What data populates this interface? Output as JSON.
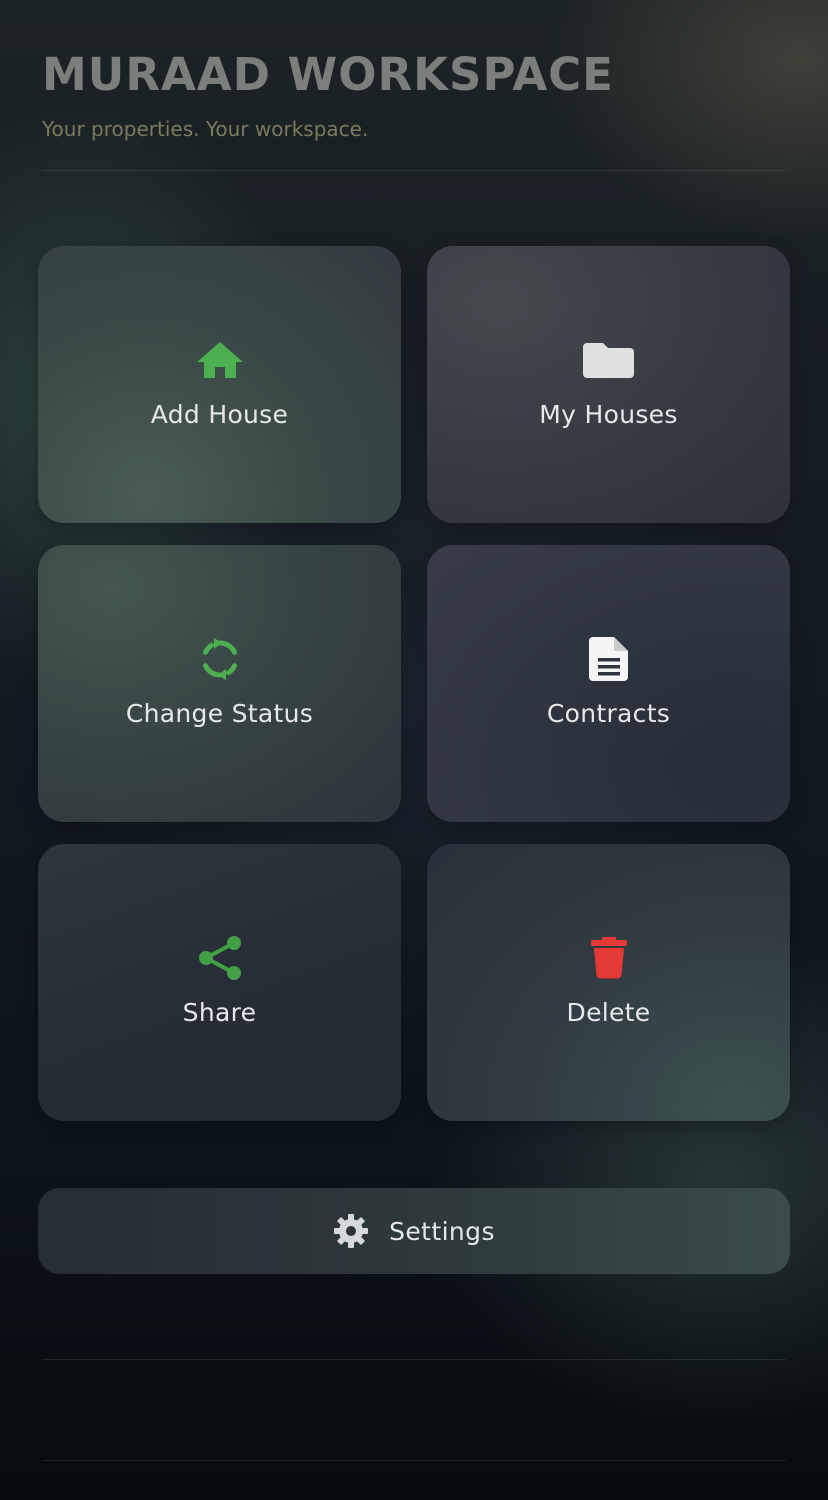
{
  "header": {
    "title": "MURAAD WORKSPACE",
    "subtitle": "Your properties. Your workspace."
  },
  "tiles": [
    {
      "label": "Add House",
      "icon": "house-icon",
      "icon_color": "#4caf50"
    },
    {
      "label": "My Houses",
      "icon": "folder-icon",
      "icon_color": "#e0e0e0"
    },
    {
      "label": "Change Status",
      "icon": "refresh-icon",
      "icon_color": "#4caf50"
    },
    {
      "label": "Contracts",
      "icon": "document-icon",
      "icon_color": "#f5f5f5"
    },
    {
      "label": "Share",
      "icon": "share-icon",
      "icon_color": "#43a047"
    },
    {
      "label": "Delete",
      "icon": "trash-icon",
      "icon_color": "#e53935"
    }
  ],
  "settings": {
    "label": "Settings",
    "icon": "gear-icon",
    "icon_color": "#d6d8da"
  }
}
